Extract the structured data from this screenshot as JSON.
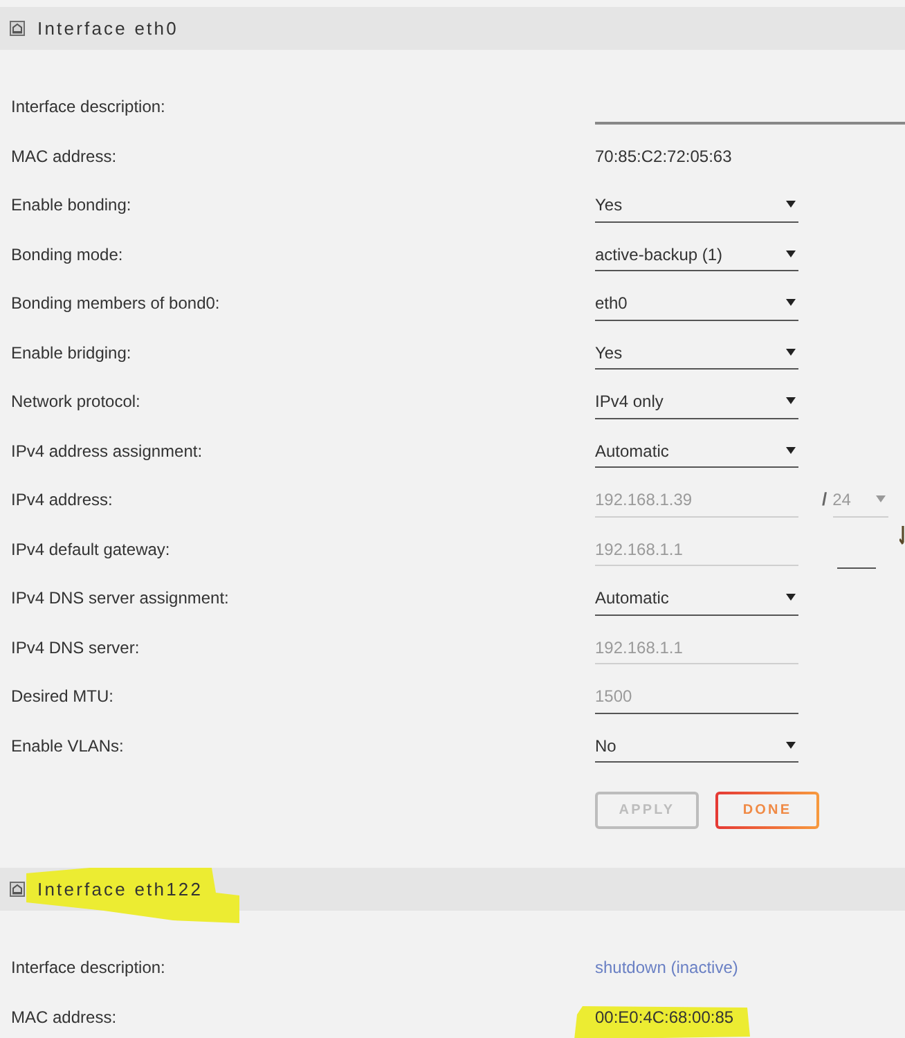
{
  "interfaces": [
    {
      "title": "Interface eth0",
      "highlighted": false,
      "fields": [
        {
          "kind": "wide_input",
          "label": "Interface description:",
          "disabled": false
        },
        {
          "kind": "text",
          "label": "MAC address:",
          "value": "70:85:C2:72:05:63",
          "highlighted": false
        },
        {
          "kind": "select",
          "label": "Enable bonding:",
          "value": "Yes",
          "disabled": false
        },
        {
          "kind": "select",
          "label": "Bonding mode:",
          "value": "active-backup (1)",
          "disabled": false
        },
        {
          "kind": "select",
          "label": "Bonding members of bond0:",
          "value": "eth0",
          "disabled": false
        },
        {
          "kind": "select",
          "label": "Enable bridging:",
          "value": "Yes",
          "disabled": false
        },
        {
          "kind": "select",
          "label": "Network protocol:",
          "value": "IPv4 only",
          "disabled": false
        },
        {
          "kind": "select",
          "label": "IPv4 address assignment:",
          "value": "Automatic",
          "disabled": false
        },
        {
          "kind": "input",
          "label": "IPv4 address:",
          "value": "192.168.1.39",
          "disabled": true,
          "prefix": {
            "separator": "/",
            "value": "24",
            "disabled": true
          }
        },
        {
          "kind": "input",
          "label": "IPv4 default gateway:",
          "value": "192.168.1.1",
          "disabled": true,
          "side_field": {
            "disabled": false
          }
        },
        {
          "kind": "select",
          "label": "IPv4 DNS server assignment:",
          "value": "Automatic",
          "disabled": false
        },
        {
          "kind": "input",
          "label": "IPv4 DNS server:",
          "value": "192.168.1.1",
          "disabled": true
        },
        {
          "kind": "input",
          "label": "Desired MTU:",
          "placeholder": "1500",
          "disabled": false
        },
        {
          "kind": "select",
          "label": "Enable VLANs:",
          "value": "No",
          "disabled": false
        }
      ],
      "buttons": [
        {
          "label": "APPLY",
          "kind": "secondary",
          "disabled": true
        },
        {
          "label": "DONE",
          "kind": "primary",
          "disabled": false
        }
      ]
    },
    {
      "title": "Interface eth122",
      "highlighted": true,
      "fields": [
        {
          "kind": "link",
          "label": "Interface description:",
          "value": "shutdown (inactive)"
        },
        {
          "kind": "text",
          "label": "MAC address:",
          "value": "00:E0:4C:68:00:85",
          "highlighted": true
        }
      ]
    }
  ]
}
